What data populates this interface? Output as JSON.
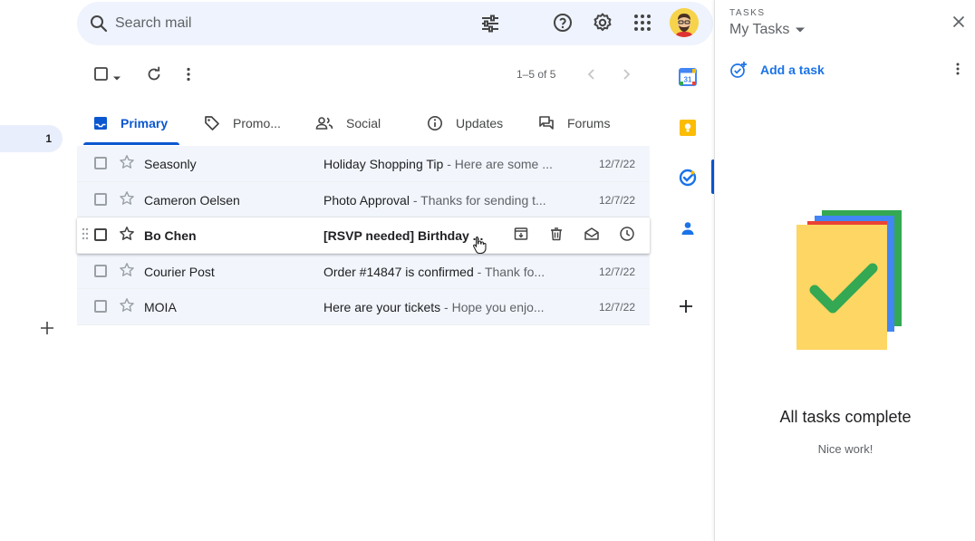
{
  "nav": {
    "inbox_count": "1"
  },
  "search": {
    "placeholder": "Search mail"
  },
  "toolbar": {
    "pager": "1–5 of 5"
  },
  "tabs": [
    {
      "label": "Primary",
      "icon": "inbox-icon",
      "active": true
    },
    {
      "label": "Promo...",
      "icon": "tag-icon"
    },
    {
      "label": "Social",
      "icon": "people-icon"
    },
    {
      "label": "Updates",
      "icon": "info-icon"
    },
    {
      "label": "Forums",
      "icon": "forum-icon"
    }
  ],
  "emails": [
    {
      "sender": "Seasonly",
      "subject": "Holiday Shopping Tip",
      "snippet": " - Here are some ...",
      "date": "12/7/22"
    },
    {
      "sender": "Cameron Oelsen",
      "subject": "Photo Approval",
      "snippet": " - Thanks for sending t...",
      "date": "12/7/22"
    },
    {
      "sender": "Bo Chen",
      "subject": "[RSVP needed] Birthday ...",
      "snippet": "",
      "date": ""
    },
    {
      "sender": "Courier Post",
      "subject": "Order #14847 is confirmed",
      "snippet": " - Thank fo...",
      "date": "12/7/22"
    },
    {
      "sender": "MOIA",
      "subject": "Here are your tickets",
      "snippet": " - Hope you enjo...",
      "date": "12/7/22"
    }
  ],
  "tasks": {
    "label": "TASKS",
    "list_name": "My Tasks",
    "add_label": "Add a task",
    "empty_title": "All tasks complete",
    "empty_sub": "Nice work!"
  },
  "apps": {
    "calendar_day": "31"
  },
  "colors": {
    "accent": "#0b57d0",
    "search_bg": "#eef3fd",
    "check_green": "#34a853"
  }
}
